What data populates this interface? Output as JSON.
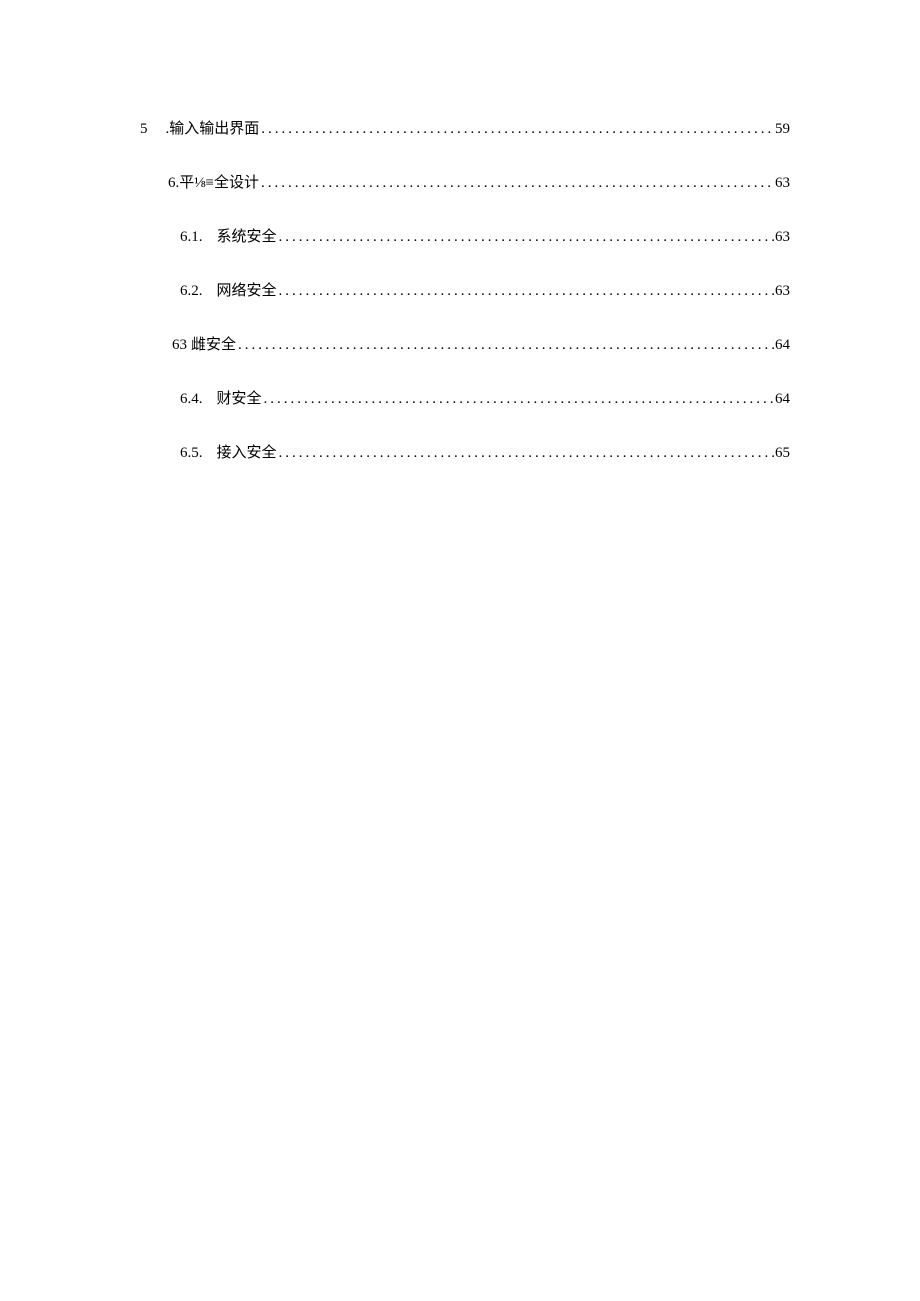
{
  "toc": [
    {
      "number": "5",
      "title": ".输入输出界面",
      "page": "59",
      "level": "level-0",
      "gap": ""
    },
    {
      "number": "6.",
      "title": "平⅛≡全设计",
      "page": "63",
      "level": "level-1",
      "gap": ""
    },
    {
      "number": "6.1.",
      "title": "系统安全",
      "page": "63",
      "level": "level-2",
      "gap": "gap-md"
    },
    {
      "number": "6.2.",
      "title": "网络安全",
      "page": "63",
      "level": "level-2",
      "gap": "gap-md"
    },
    {
      "number": "63",
      "title": "雌安全",
      "page": "64",
      "level": "level-2b",
      "gap": "gap-sm"
    },
    {
      "number": "6.4.",
      "title": "财安全",
      "page": "64",
      "level": "level-2",
      "gap": "gap-md"
    },
    {
      "number": "6.5.",
      "title": "接入安全",
      "page": "65",
      "level": "level-2",
      "gap": "gap-md"
    }
  ]
}
